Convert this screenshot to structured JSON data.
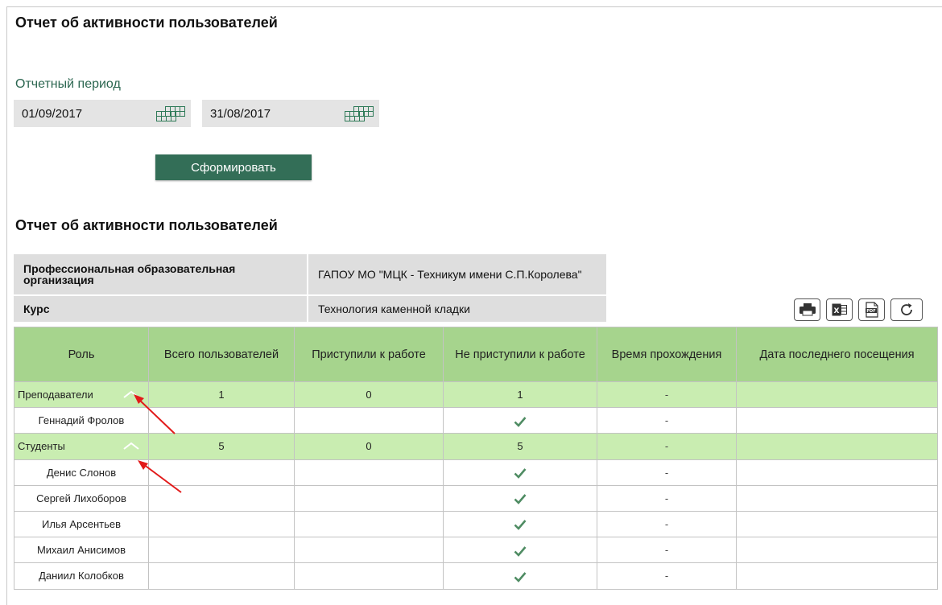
{
  "page": {
    "title": "Отчет об активности пользователей",
    "period_label": "Отчетный период",
    "date_from": "01/09/2017",
    "date_to": "31/08/2017",
    "submit_label": "Сформировать"
  },
  "report": {
    "title": "Отчет об активности пользователей",
    "org_key": "Профессиональная образовательная организация",
    "org_value": "ГАПОУ МО \"МЦК - Техникум имени С.П.Королева\"",
    "course_key": "Курс",
    "course_value": "Технология каменной кладки"
  },
  "toolbar": {
    "icons": [
      "print-icon",
      "excel-icon",
      "pdf-icon",
      "refresh-icon"
    ]
  },
  "table": {
    "headers": {
      "role": "Роль",
      "total": "Всего пользователей",
      "started": "Приступили к работе",
      "not_started": "Не приступили к работе",
      "time": "Время прохождения",
      "last_visit": "Дата последнего посещения"
    },
    "groups": [
      {
        "name": "Преподаватели",
        "total": "1",
        "started": "0",
        "not_started": "1",
        "time": "-",
        "last_visit": "",
        "members": [
          {
            "name": "Геннадий Фролов",
            "time": "-"
          }
        ]
      },
      {
        "name": "Студенты",
        "total": "5",
        "started": "0",
        "not_started": "5",
        "time": "-",
        "last_visit": "",
        "members": [
          {
            "name": "Денис Слонов",
            "time": "-"
          },
          {
            "name": "Сергей Лихоборов",
            "time": "-"
          },
          {
            "name": "Илья Арсентьев",
            "time": "-"
          },
          {
            "name": "Михаил Анисимов",
            "time": "-"
          },
          {
            "name": "Даниил Колобков",
            "time": "-"
          }
        ]
      }
    ]
  },
  "colors": {
    "accent": "#336e57",
    "header_bg": "#a6d48d",
    "group_bg": "#c9edb1",
    "check": "#4f8c63",
    "annotation_arrow": "#e21a1a"
  }
}
